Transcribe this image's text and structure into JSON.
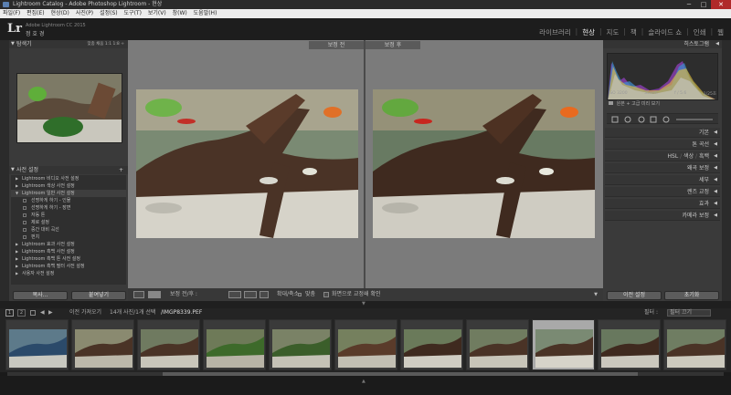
{
  "window": {
    "title": "Lightroom Catalog - Adobe Photoshop Lightroom - 현상",
    "minimize": "─",
    "maximize": "□",
    "close": "✕"
  },
  "menu": [
    "파일(F)",
    "편집(E)",
    "현상(D)",
    "사진(P)",
    "설정(S)",
    "도구(T)",
    "보기(V)",
    "창(W)",
    "도움말(H)"
  ],
  "identity": {
    "logo": "Lr",
    "product": "Adobe Lightroom CC 2015",
    "user": "정 호 경"
  },
  "modules": {
    "items": [
      "라이브러리",
      "현상",
      "지도",
      "책",
      "슬라이드 쇼",
      "인쇄",
      "웹"
    ],
    "active": "현상",
    "separator": "|"
  },
  "left": {
    "navigator": {
      "title": "탐색기",
      "zoom": "맞춤  채움  1:1  1:8 ÷"
    },
    "presets": {
      "title": "사전 설정",
      "add": "+",
      "items": [
        {
          "label": "Lightroom 비디오 사전 설정",
          "kind": "folder"
        },
        {
          "label": "Lightroom 색상 사전 설정",
          "kind": "folder"
        },
        {
          "label": "Lightroom 일반 사전 설정",
          "kind": "folder-open"
        },
        {
          "label": "선명하게 하기 - 인물",
          "kind": "sub"
        },
        {
          "label": "선명하게 하기 - 장면",
          "kind": "sub"
        },
        {
          "label": "자동 톤",
          "kind": "sub"
        },
        {
          "label": "제로 설정",
          "kind": "sub"
        },
        {
          "label": "중간 대비 곡선",
          "kind": "sub"
        },
        {
          "label": "펀치",
          "kind": "sub"
        },
        {
          "label": "Lightroom 효과 사전 설정",
          "kind": "folder"
        },
        {
          "label": "Lightroom 흑백 사전 설정",
          "kind": "folder"
        },
        {
          "label": "Lightroom 흑백 톤 사전 설정",
          "kind": "folder"
        },
        {
          "label": "Lightroom 흑백 필터 사전 설정",
          "kind": "folder"
        },
        {
          "label": "사용자 사전 설정",
          "kind": "folder"
        }
      ]
    },
    "copy_button": "복사...",
    "paste_button": "붙여넣기"
  },
  "center": {
    "before_label": "보정 전",
    "after_label": "보정 후",
    "toolbar": {
      "view_label": "보정 전/후 :",
      "zoom_label": "확대/축소",
      "fit_label": "맞춤",
      "softproof_label": "화면으로 교정쇄 확인"
    }
  },
  "right": {
    "histogram": {
      "title": "히스토그램",
      "iso": "ISO 3200",
      "focal": "35mm",
      "aperture": "f / 5.6",
      "shutter": "1/25초",
      "original_label": "원본 + 고급 미리 보기"
    },
    "sections": [
      "기본",
      "톤 곡선",
      "렌즈 교정",
      "왜곡 보정",
      "세부",
      "렌즈 교정",
      "효과",
      "카메라 보정"
    ],
    "hsl": {
      "hsl": "HSL",
      "color": "색상",
      "bw": "흑백"
    },
    "previous_button": "이전 설정",
    "reset_button": "초기화"
  },
  "filmstrip": {
    "page1": "1",
    "page2": "2",
    "source_label": "이전 가져오기",
    "count_label": "14개 사진/1개 선택",
    "filename": "/IMGP8339.PEF",
    "filter_label": "필터 :",
    "filter_value": "필터 끄기",
    "selected_index": 8,
    "count": 11
  },
  "colors": {
    "accent_active": "#f0f0f0",
    "panel_bg": "#3a3a3a",
    "close_red": "#b02a2a"
  }
}
